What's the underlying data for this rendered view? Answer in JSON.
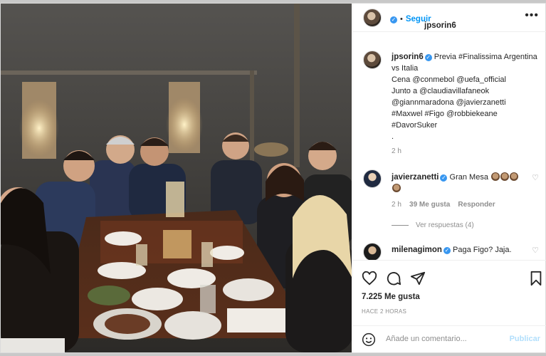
{
  "post": {
    "username": "jpsorin6",
    "follow_label": "Seguir",
    "more_label": "•••"
  },
  "caption": {
    "username": "jpsorin6",
    "text_lines": [
      "Previa #Finalissima Argentina",
      "vs Italia",
      "Cena @conmebol @uefa_official",
      "Junto a @claudiavillafaneok",
      "@giannmaradona @javierzanetti",
      "#Maxwel #Figo @robbiekeane",
      "#DavorSuker",
      "."
    ],
    "time": "2 h"
  },
  "comments": [
    {
      "username": "javierzanetti",
      "text": "Gran Mesa",
      "time": "2 h",
      "likes": "39 Me gusta",
      "reply_label": "Responder",
      "view_replies": "Ver respuestas (4)"
    },
    {
      "username": "milenagimon",
      "text": "Paga Figo? Jaja."
    }
  ],
  "footer": {
    "likes": "7.225 Me gusta",
    "time_ago": "HACE 2 HORAS",
    "comment_placeholder": "Añade un comentario...",
    "publish_label": "Publicar"
  },
  "icons": {
    "like": "heart-icon",
    "comment": "comment-icon",
    "share": "share-icon",
    "save": "bookmark-icon",
    "emoji": "smile-icon",
    "verified": "verified-badge-icon"
  },
  "colors": {
    "link_blue": "#0095f6",
    "verified_blue": "#3897f0",
    "secondary_text": "#8e8e8e"
  }
}
